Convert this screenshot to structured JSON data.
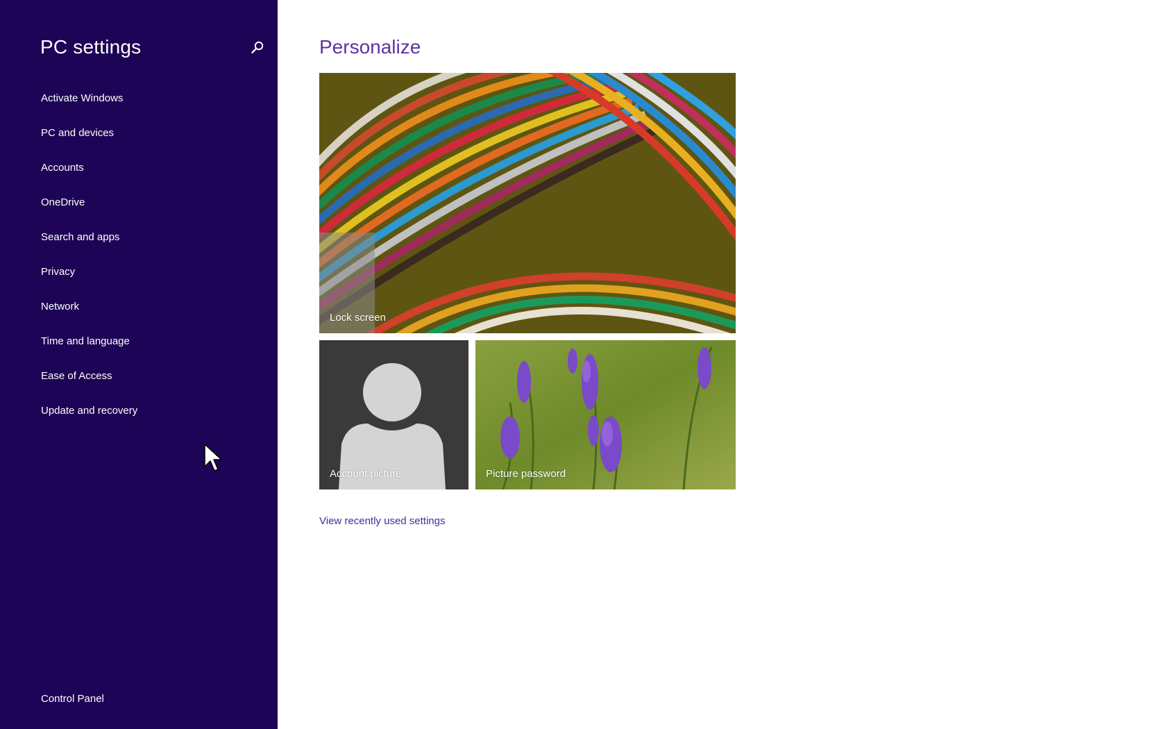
{
  "sidebar": {
    "title": "PC settings",
    "search_icon": "search-icon",
    "items": [
      {
        "label": "Activate Windows"
      },
      {
        "label": "PC and devices"
      },
      {
        "label": "Accounts"
      },
      {
        "label": "OneDrive"
      },
      {
        "label": "Search and apps"
      },
      {
        "label": "Privacy"
      },
      {
        "label": "Network"
      },
      {
        "label": "Time and language"
      },
      {
        "label": "Ease of Access"
      },
      {
        "label": "Update and recovery"
      }
    ],
    "control_panel": "Control Panel",
    "background_color": "#1e0456"
  },
  "main": {
    "title": "Personalize",
    "title_color": "#5b34a3",
    "tiles": {
      "lock_screen": "Lock screen",
      "account_picture": "Account picture",
      "picture_password": "Picture password"
    },
    "recent_link": "View recently used settings"
  }
}
